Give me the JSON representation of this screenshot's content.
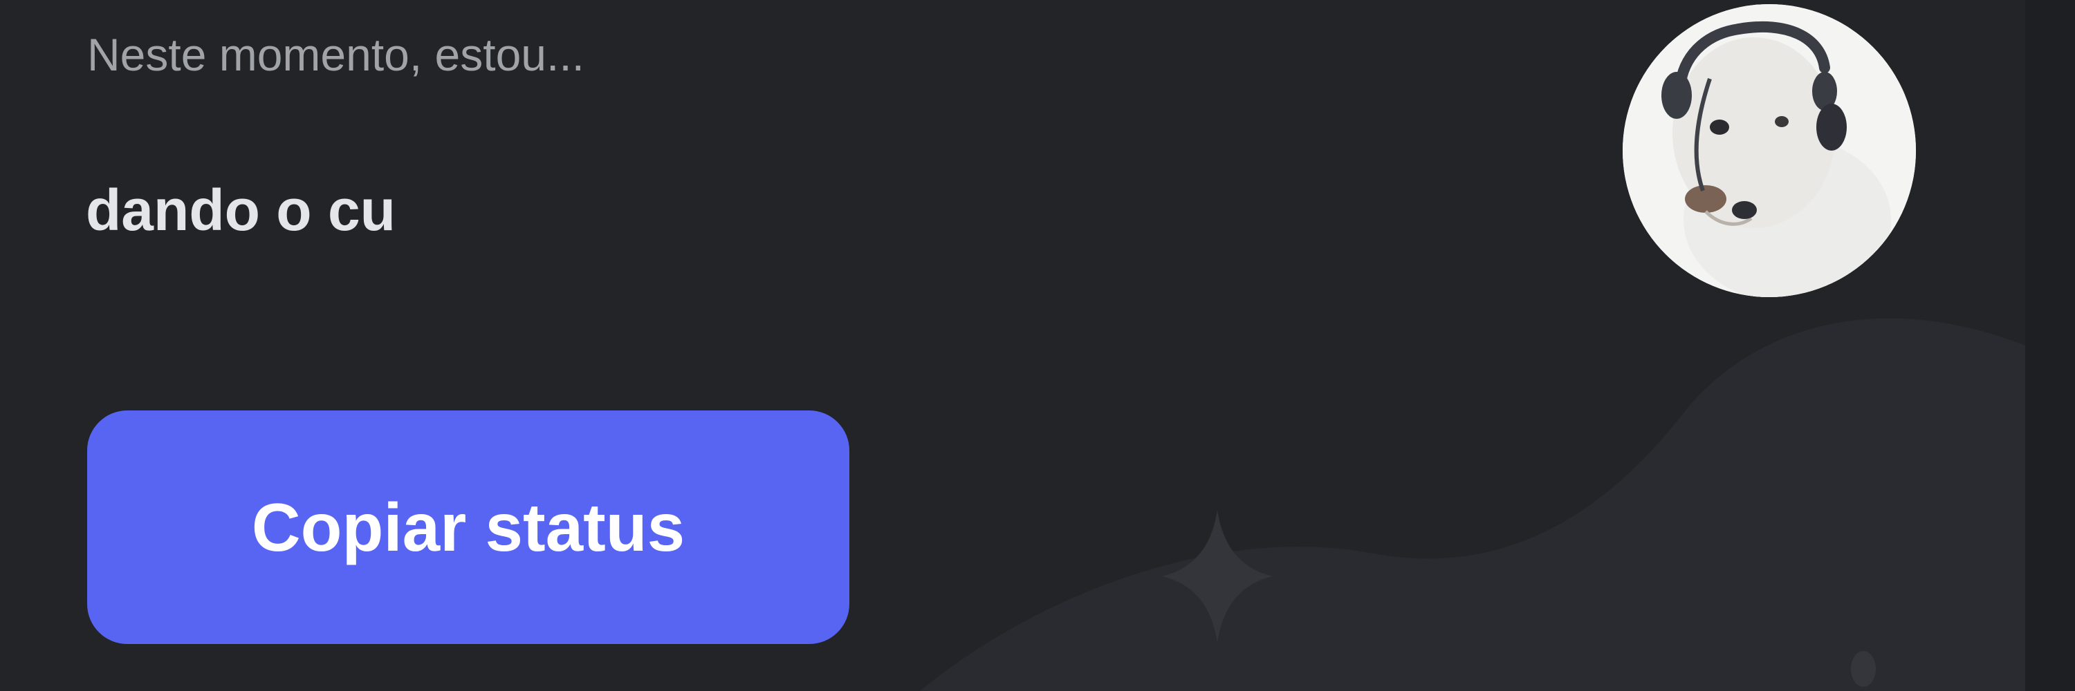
{
  "status": {
    "caption": "Neste momento, estou...",
    "text": "dando o cu"
  },
  "actions": {
    "copy_label": "Copiar status"
  },
  "avatar": {
    "icon": "dog-with-headset-avatar"
  },
  "decoration": {
    "icon": "sparkle-icon"
  },
  "colors": {
    "background": "#232428",
    "accent": "#5865f2",
    "primary_text": "#e3e5e8",
    "secondary_text": "#a0a3a8"
  }
}
